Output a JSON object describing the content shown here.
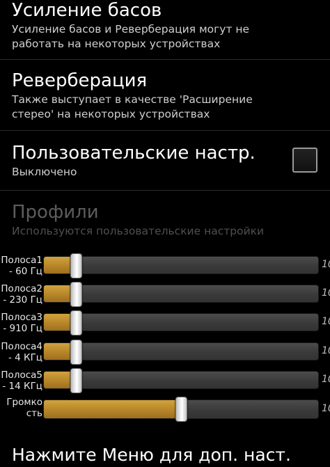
{
  "bass": {
    "title": "Усиление басов",
    "summary_line1": "Усиление басов и Реверберация могут не",
    "summary_line2": "работать на некоторых устройствах"
  },
  "reverb": {
    "title": "Реверберация",
    "summary_line1": "Также выступает в качестве 'Расширение",
    "summary_line2": "стерео' на некоторых устройствах"
  },
  "custom": {
    "title": "Пользовательские настр.",
    "summary": "Выключено",
    "checked": false
  },
  "profiles": {
    "title": "Профили",
    "summary": "Используются пользовательские настройки",
    "enabled": false
  },
  "bands": [
    {
      "label_line1": "Полоса1",
      "label_line2": "- 60 Гц",
      "max_label": "10",
      "value_fraction": 0.12
    },
    {
      "label_line1": "Полоса2",
      "label_line2": "- 230 Гц",
      "max_label": "10",
      "value_fraction": 0.12
    },
    {
      "label_line1": "Полоса3",
      "label_line2": "- 910 Гц",
      "max_label": "10",
      "value_fraction": 0.12
    },
    {
      "label_line1": "Полоса4",
      "label_line2": "- 4 КГц",
      "max_label": "10",
      "value_fraction": 0.12
    },
    {
      "label_line1": "Полоса5",
      "label_line2": "- 14 КГц",
      "max_label": "10",
      "value_fraction": 0.12
    }
  ],
  "volume": {
    "label_line1": "Громко",
    "label_line2": "сть",
    "max_label": "10",
    "value_fraction": 0.5
  },
  "footer": {
    "text": "Нажмите Меню для доп. наст."
  },
  "colors": {
    "fill": "#b7852a",
    "track": "#3a3a3a",
    "background": "#000000"
  }
}
